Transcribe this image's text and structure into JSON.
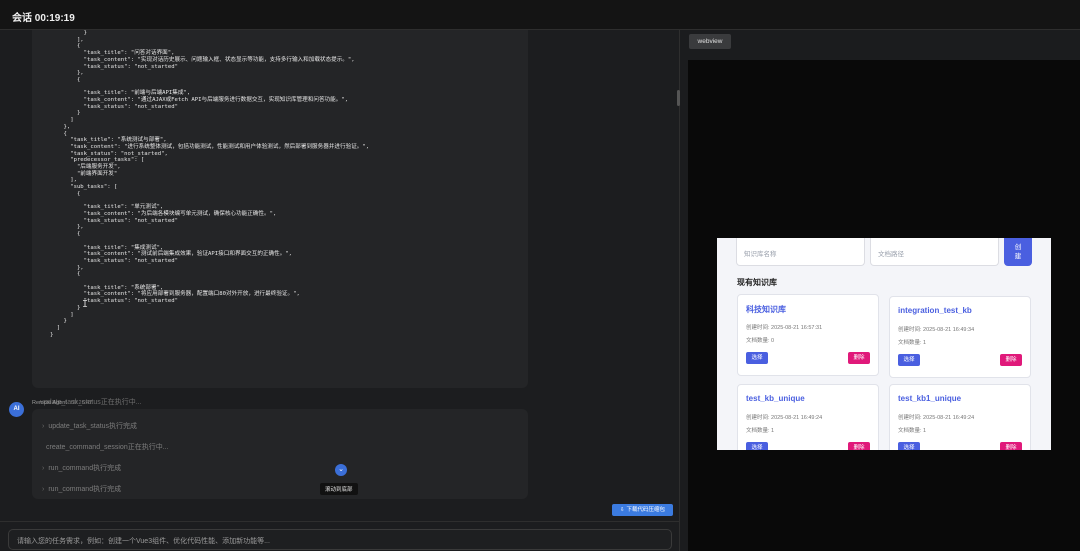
{
  "header": {
    "title": "会话 00:19:19"
  },
  "code_block": {
    "lines": [
      "          }",
      "        ],",
      "        {",
      "          \"task_title\": \"问答对话界面\",",
      "          \"task_content\": \"实现对话历史展示、问题输入框、状态显示等功能，支持多行输入和加载状态提示。\",",
      "          \"task_status\": \"not_started\"",
      "        },",
      "        {",
      "",
      "          \"task_title\": \"前端与后端API集成\",",
      "          \"task_content\": \"通过AJAX或Fetch API与后端服务进行数据交互，实现知识库管理和问答功能。\",",
      "          \"task_status\": \"not_started\"",
      "        }",
      "      ]",
      "    },",
      "    {",
      "      \"task_title\": \"系统测试与部署\",",
      "      \"task_content\": \"进行系统整体测试，包括功能测试，性能测试和用户体验测试，然后部署到服务器并进行验证。\",",
      "      \"task_status\": \"not_started\",",
      "      \"predecessor_tasks\": [",
      "        \"后端服务开发\",",
      "        \"前端界面开发\"",
      "      ],",
      "      \"sub_tasks\": [",
      "        {",
      "",
      "          \"task_title\": \"单元测试\",",
      "          \"task_content\": \"为后端各模块编写单元测试，确保核心功能正确性。\",",
      "          \"task_status\": \"not_started\"",
      "        },",
      "        {",
      "",
      "          \"task_title\": \"集成测试\",",
      "          \"task_content\": \"测试前后端集成效果，验证API接口和界面交互的正确性。\",",
      "          \"task_status\": \"not_started\"",
      "        },",
      "        {",
      "",
      "          \"task_title\": \"系统部署\",",
      "          \"task_content\": \"将应用部署到服务器，配置端口80对外开放，进行最终验证。\",",
      "          \"task_status\": \"not_started\"",
      "        }",
      "      ]",
      "    }",
      "  ]",
      "}"
    ],
    "status": "update_task_status正在执行中..."
  },
  "agent": {
    "avatar": "AI",
    "name": "Remote Agent",
    "time": "00:26:47",
    "logs": [
      {
        "chevron": "›",
        "text": "update_task_status执行完成"
      },
      {
        "chevron": "",
        "text": "create_command_session正在执行中..."
      },
      {
        "chevron": "›",
        "text": "run_command执行完成"
      },
      {
        "chevron": "›",
        "text": "run_command执行完成"
      }
    ]
  },
  "scroll_bottom": {
    "icon": "arrow-down-icon",
    "glyph": "⌄",
    "tooltip": "滚动到底部"
  },
  "download": {
    "icon": "download-icon",
    "glyph": "⇩",
    "label": "下载代码压缩包"
  },
  "chat_input": {
    "placeholder": "请输入您的任务需求，例如：创建一个Vue3组件、优化代码性能、添加新功能等..."
  },
  "webview_tab": {
    "label": "webview"
  },
  "kb": {
    "name_placeholder": "知识库名称",
    "path_placeholder": "文档路径",
    "create_label_1": "创",
    "create_label_2": "建",
    "heading": "现有知识库",
    "cards": [
      {
        "name": "科技知识库",
        "created": "创建时间: 2025-08-21 16:57:31",
        "docs": "文档数量: 0",
        "select": "选择",
        "delete": "删除"
      },
      {
        "name": "integration_test_kb",
        "created": "创建时间: 2025-08-21 16:49:34",
        "docs": "文档数量: 1",
        "select": "选择",
        "delete": "删除"
      },
      {
        "name": "test_kb_unique",
        "created": "创建时间: 2025-08-21 16:49:24",
        "docs": "文档数量: 1",
        "select": "选择",
        "delete": "删除"
      },
      {
        "name": "test_kb1_unique",
        "created": "创建时间: 2025-08-21 16:49:24",
        "docs": "文档数量: 1",
        "select": "选择",
        "delete": "删除"
      }
    ]
  },
  "colors": {
    "accent": "#3b6fd8",
    "kb_primary": "#4a5fe0",
    "kb_danger": "#e0197a"
  }
}
